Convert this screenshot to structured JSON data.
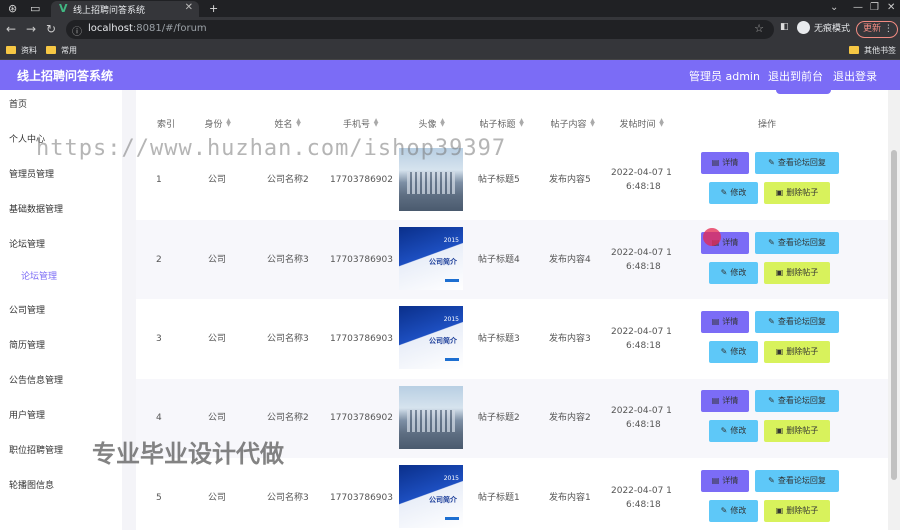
{
  "browser": {
    "tab_title": "线上招聘问答系统",
    "url_host": "localhost",
    "url_path": ":8081/#/forum",
    "incognito_label": "无痕模式",
    "update_label": "更新",
    "bookmarks": [
      "资料",
      "常用"
    ],
    "other_bookmarks": "其他书签"
  },
  "app": {
    "title": "线上招聘问答系统",
    "admin_label": "管理员 admin",
    "back_label": "退出到前台",
    "logout_label": "退出登录"
  },
  "sidebar": {
    "items": [
      {
        "label": "首页"
      },
      {
        "label": "个人中心"
      },
      {
        "label": "管理员管理"
      },
      {
        "label": "基础数据管理"
      },
      {
        "label": "论坛管理"
      },
      {
        "label": "论坛管理"
      },
      {
        "label": "公司管理"
      },
      {
        "label": "简历管理"
      },
      {
        "label": "公告信息管理"
      },
      {
        "label": "用户管理"
      },
      {
        "label": "职位招聘管理"
      },
      {
        "label": "轮播图信息"
      }
    ]
  },
  "table": {
    "columns": [
      "索引",
      "身份",
      "姓名",
      "手机号",
      "头像",
      "帖子标题",
      "帖子内容",
      "发帖时间",
      "操作"
    ],
    "rows": [
      {
        "index": "1",
        "identity": "公司",
        "name": "公司名称2",
        "phone": "17703786902",
        "avatar": "building",
        "title": "帖子标题5",
        "content": "发布内容5",
        "time1": "2022-04-07 1",
        "time2": "6:48:18"
      },
      {
        "index": "2",
        "identity": "公司",
        "name": "公司名称3",
        "phone": "17703786903",
        "avatar": "brochure",
        "title": "帖子标题4",
        "content": "发布内容4",
        "time1": "2022-04-07 1",
        "time2": "6:48:18"
      },
      {
        "index": "3",
        "identity": "公司",
        "name": "公司名称3",
        "phone": "17703786903",
        "avatar": "brochure",
        "title": "帖子标题3",
        "content": "发布内容3",
        "time1": "2022-04-07 1",
        "time2": "6:48:18"
      },
      {
        "index": "4",
        "identity": "公司",
        "name": "公司名称2",
        "phone": "17703786902",
        "avatar": "building",
        "title": "帖子标题2",
        "content": "发布内容2",
        "time1": "2022-04-07 1",
        "time2": "6:48:18"
      },
      {
        "index": "5",
        "identity": "公司",
        "name": "公司名称3",
        "phone": "17703786903",
        "avatar": "brochure",
        "title": "帖子标题1",
        "content": "发布内容1",
        "time1": "2022-04-07 1",
        "time2": "6:48:18"
      }
    ],
    "actions": {
      "detail": "详情",
      "view_replies": "查看论坛回复",
      "edit": "修改",
      "delete": "删除帖子"
    },
    "brochure_text": "公司简介",
    "brochure_year": "2015"
  },
  "watermarks": {
    "url": "https://www.huzhan.com/ishop39397",
    "text": "专业毕业设计代做"
  }
}
